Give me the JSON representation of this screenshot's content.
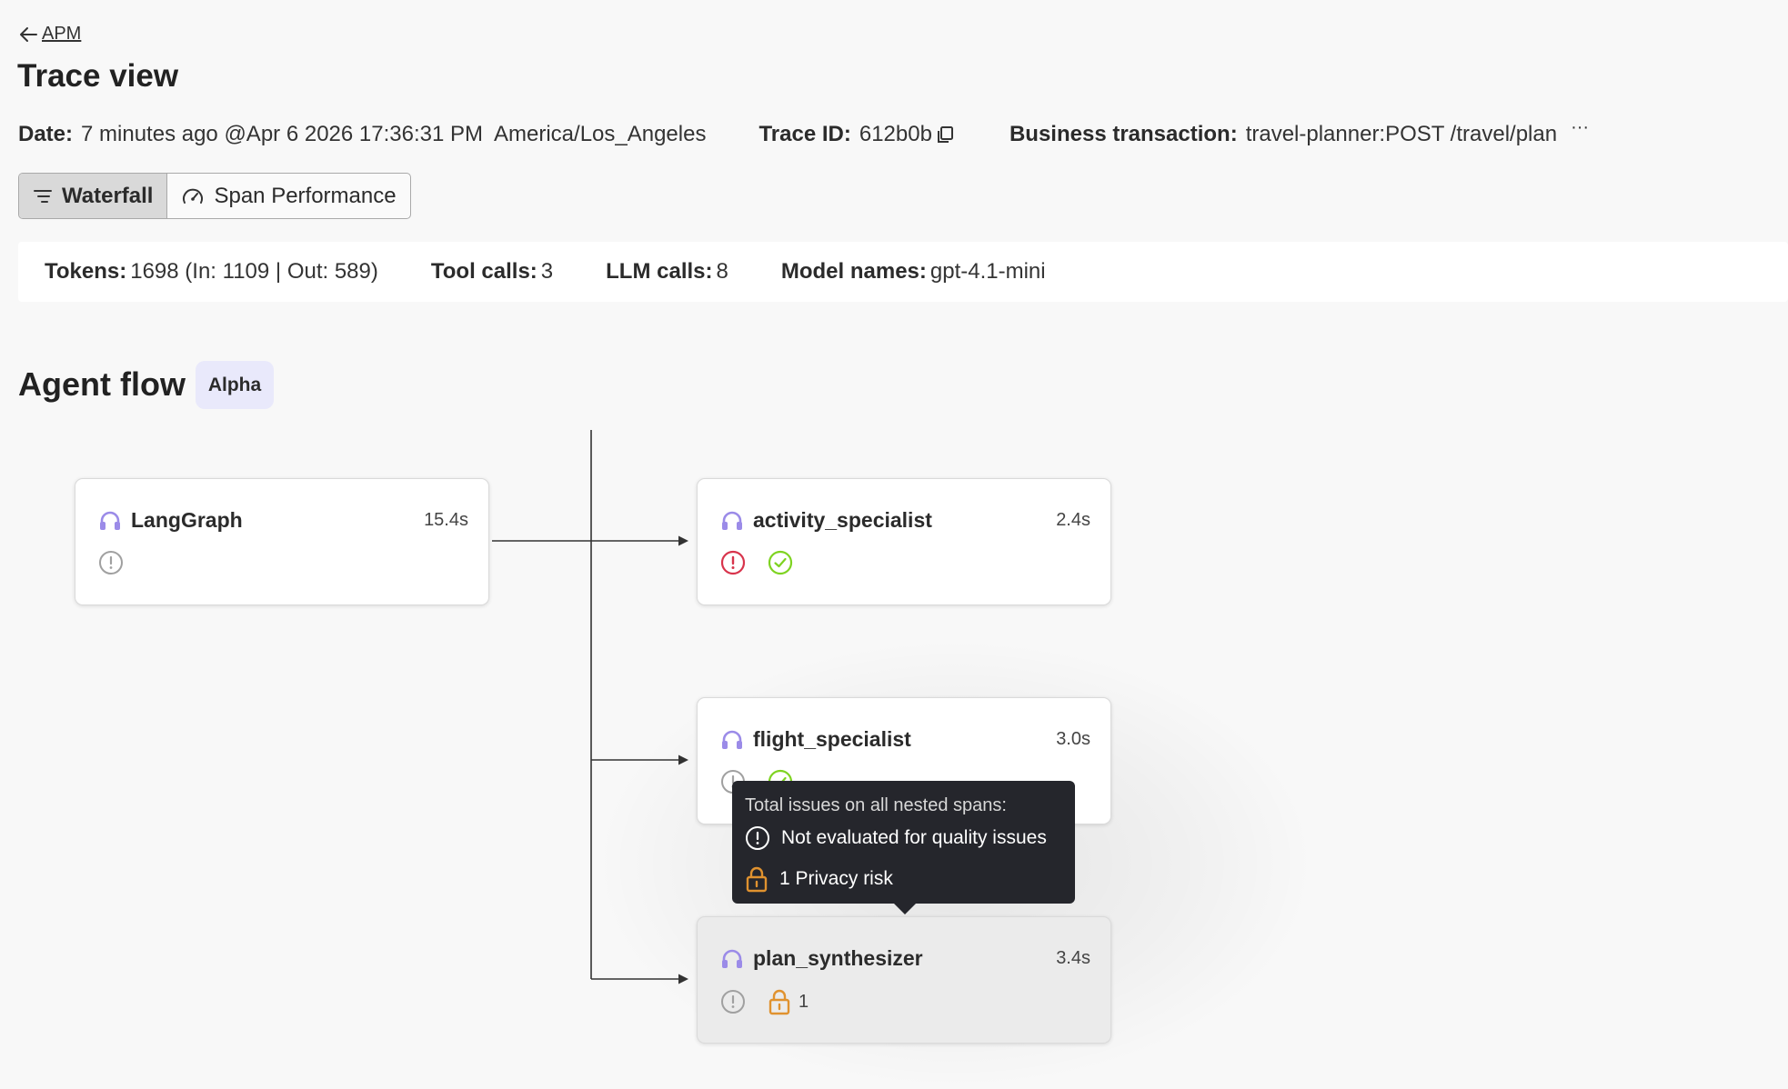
{
  "nav": {
    "back_label": "APM"
  },
  "page": {
    "title": "Trace view"
  },
  "meta": {
    "date_label": "Date:",
    "date_value": "7 minutes ago @Apr 6 2026 17:36:31 PM  America/Los_Angeles",
    "trace_label": "Trace ID:",
    "trace_value": "612b0b",
    "business_label": "Business transaction:",
    "business_value": "travel-planner:POST /travel/plan",
    "more": "···"
  },
  "view_tabs": [
    {
      "label": "Waterfall",
      "active": true
    },
    {
      "label": "Span Performance",
      "active": false
    }
  ],
  "stats": {
    "tokens_label": "Tokens:",
    "tokens_value": "1698 (In: 1109 | Out: 589)",
    "tool_label": "Tool calls:",
    "tool_value": "3",
    "llm_label": "LLM calls:",
    "llm_value": "8",
    "model_label": "Model names:",
    "model_value": "gpt-4.1-mini"
  },
  "agent_flow": {
    "title": "Agent flow",
    "badge": "Alpha"
  },
  "nodes": [
    {
      "name": "LangGraph",
      "duration": "15.4s",
      "icons": [
        "info-circle-icon"
      ]
    },
    {
      "name": "activity_specialist",
      "duration": "2.4s",
      "icons": [
        "error-circle-icon",
        "check-circle-icon"
      ]
    },
    {
      "name": "flight_specialist",
      "duration": "3.0s",
      "icons": [
        "info-circle-icon",
        "check-circle-icon"
      ]
    },
    {
      "name": "plan_synthesizer",
      "duration": "3.4s",
      "icons": [
        "info-circle-icon",
        "lock-icon"
      ],
      "lock_count": "1"
    }
  ],
  "tooltip": {
    "title": "Total issues on all nested spans:",
    "row1": "Not evaluated for quality issues",
    "row2": "1 Privacy risk"
  },
  "colors": {
    "agent_icon": "#9b8be8",
    "error": "#d8344c",
    "success": "#7ed321",
    "lock": "#e0922f",
    "neutral": "#a0a0a0"
  }
}
